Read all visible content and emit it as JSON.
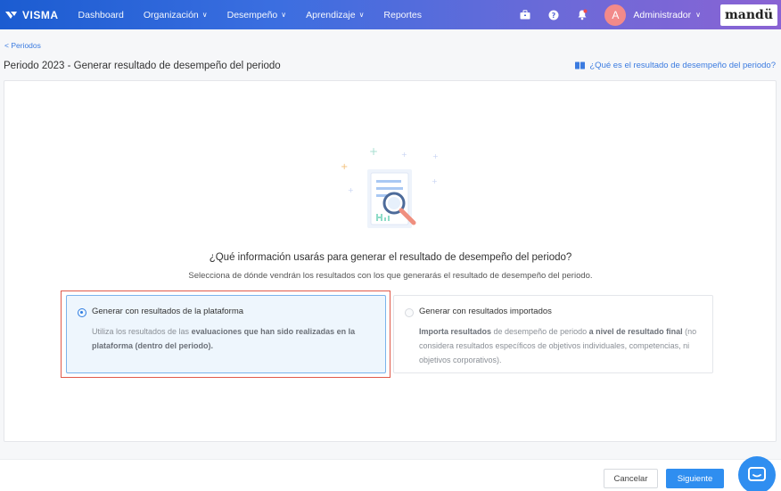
{
  "navbar": {
    "brand": "VISMA",
    "items": [
      {
        "label": "Dashboard",
        "dropdown": false
      },
      {
        "label": "Organización",
        "dropdown": true
      },
      {
        "label": "Desempeño",
        "dropdown": true
      },
      {
        "label": "Aprendizaje",
        "dropdown": true
      },
      {
        "label": "Reportes",
        "dropdown": false
      }
    ],
    "user": {
      "initial": "A",
      "name": "Administrador"
    },
    "product_logo": "mandü"
  },
  "breadcrumb": {
    "back_label": "< Periodos"
  },
  "page": {
    "title": "Periodo 2023 - Generar resultado de desempeño del periodo",
    "help_link": "¿Qué es el resultado de desempeño del periodo?"
  },
  "main": {
    "question": "¿Qué información usarás para generar el resultado de desempeño del periodo?",
    "subtitle": "Selecciona de dónde vendrán los resultados con los que generarás el resultado de desempeño del periodo.",
    "options": [
      {
        "title": "Generar con resultados de la plataforma",
        "selected": true,
        "desc_1": "Utiliza los resultados de las ",
        "desc_bold": "evaluaciones que han sido realizadas en la plataforma (dentro del periodo).",
        "desc_2": ""
      },
      {
        "title": "Generar con resultados importados",
        "selected": false,
        "desc_bold_1": "Importa resultados",
        "desc_1": " de desempeño de periodo ",
        "desc_bold_2": "a nivel de resultado final",
        "desc_2": " (no considera resultados específicos de objetivos individuales, competencias, ni objetivos corporativos)."
      }
    ]
  },
  "footer": {
    "cancel_label": "Cancelar",
    "next_label": "Siguiente"
  },
  "colors": {
    "accent": "#2f8ef0",
    "highlight": "#e05a4a",
    "link": "#3b7be0"
  }
}
